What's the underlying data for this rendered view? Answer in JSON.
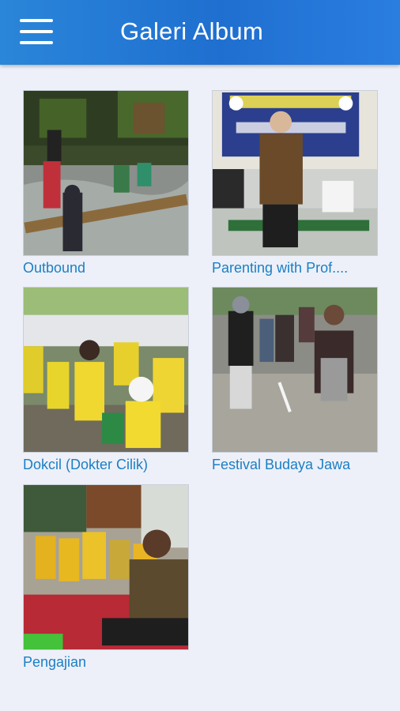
{
  "header": {
    "title": "Galeri Album",
    "menu_icon": "hamburger-menu-icon"
  },
  "albums": [
    {
      "title": "Outbound"
    },
    {
      "title": "Parenting with Prof...."
    },
    {
      "title": "Dokcil (Dokter Cilik)"
    },
    {
      "title": "Festival Budaya Jawa"
    },
    {
      "title": "Pengajian"
    }
  ],
  "colors": {
    "header": "#1f6fd0",
    "caption": "#1b7fc5",
    "background": "#edf0f8"
  }
}
